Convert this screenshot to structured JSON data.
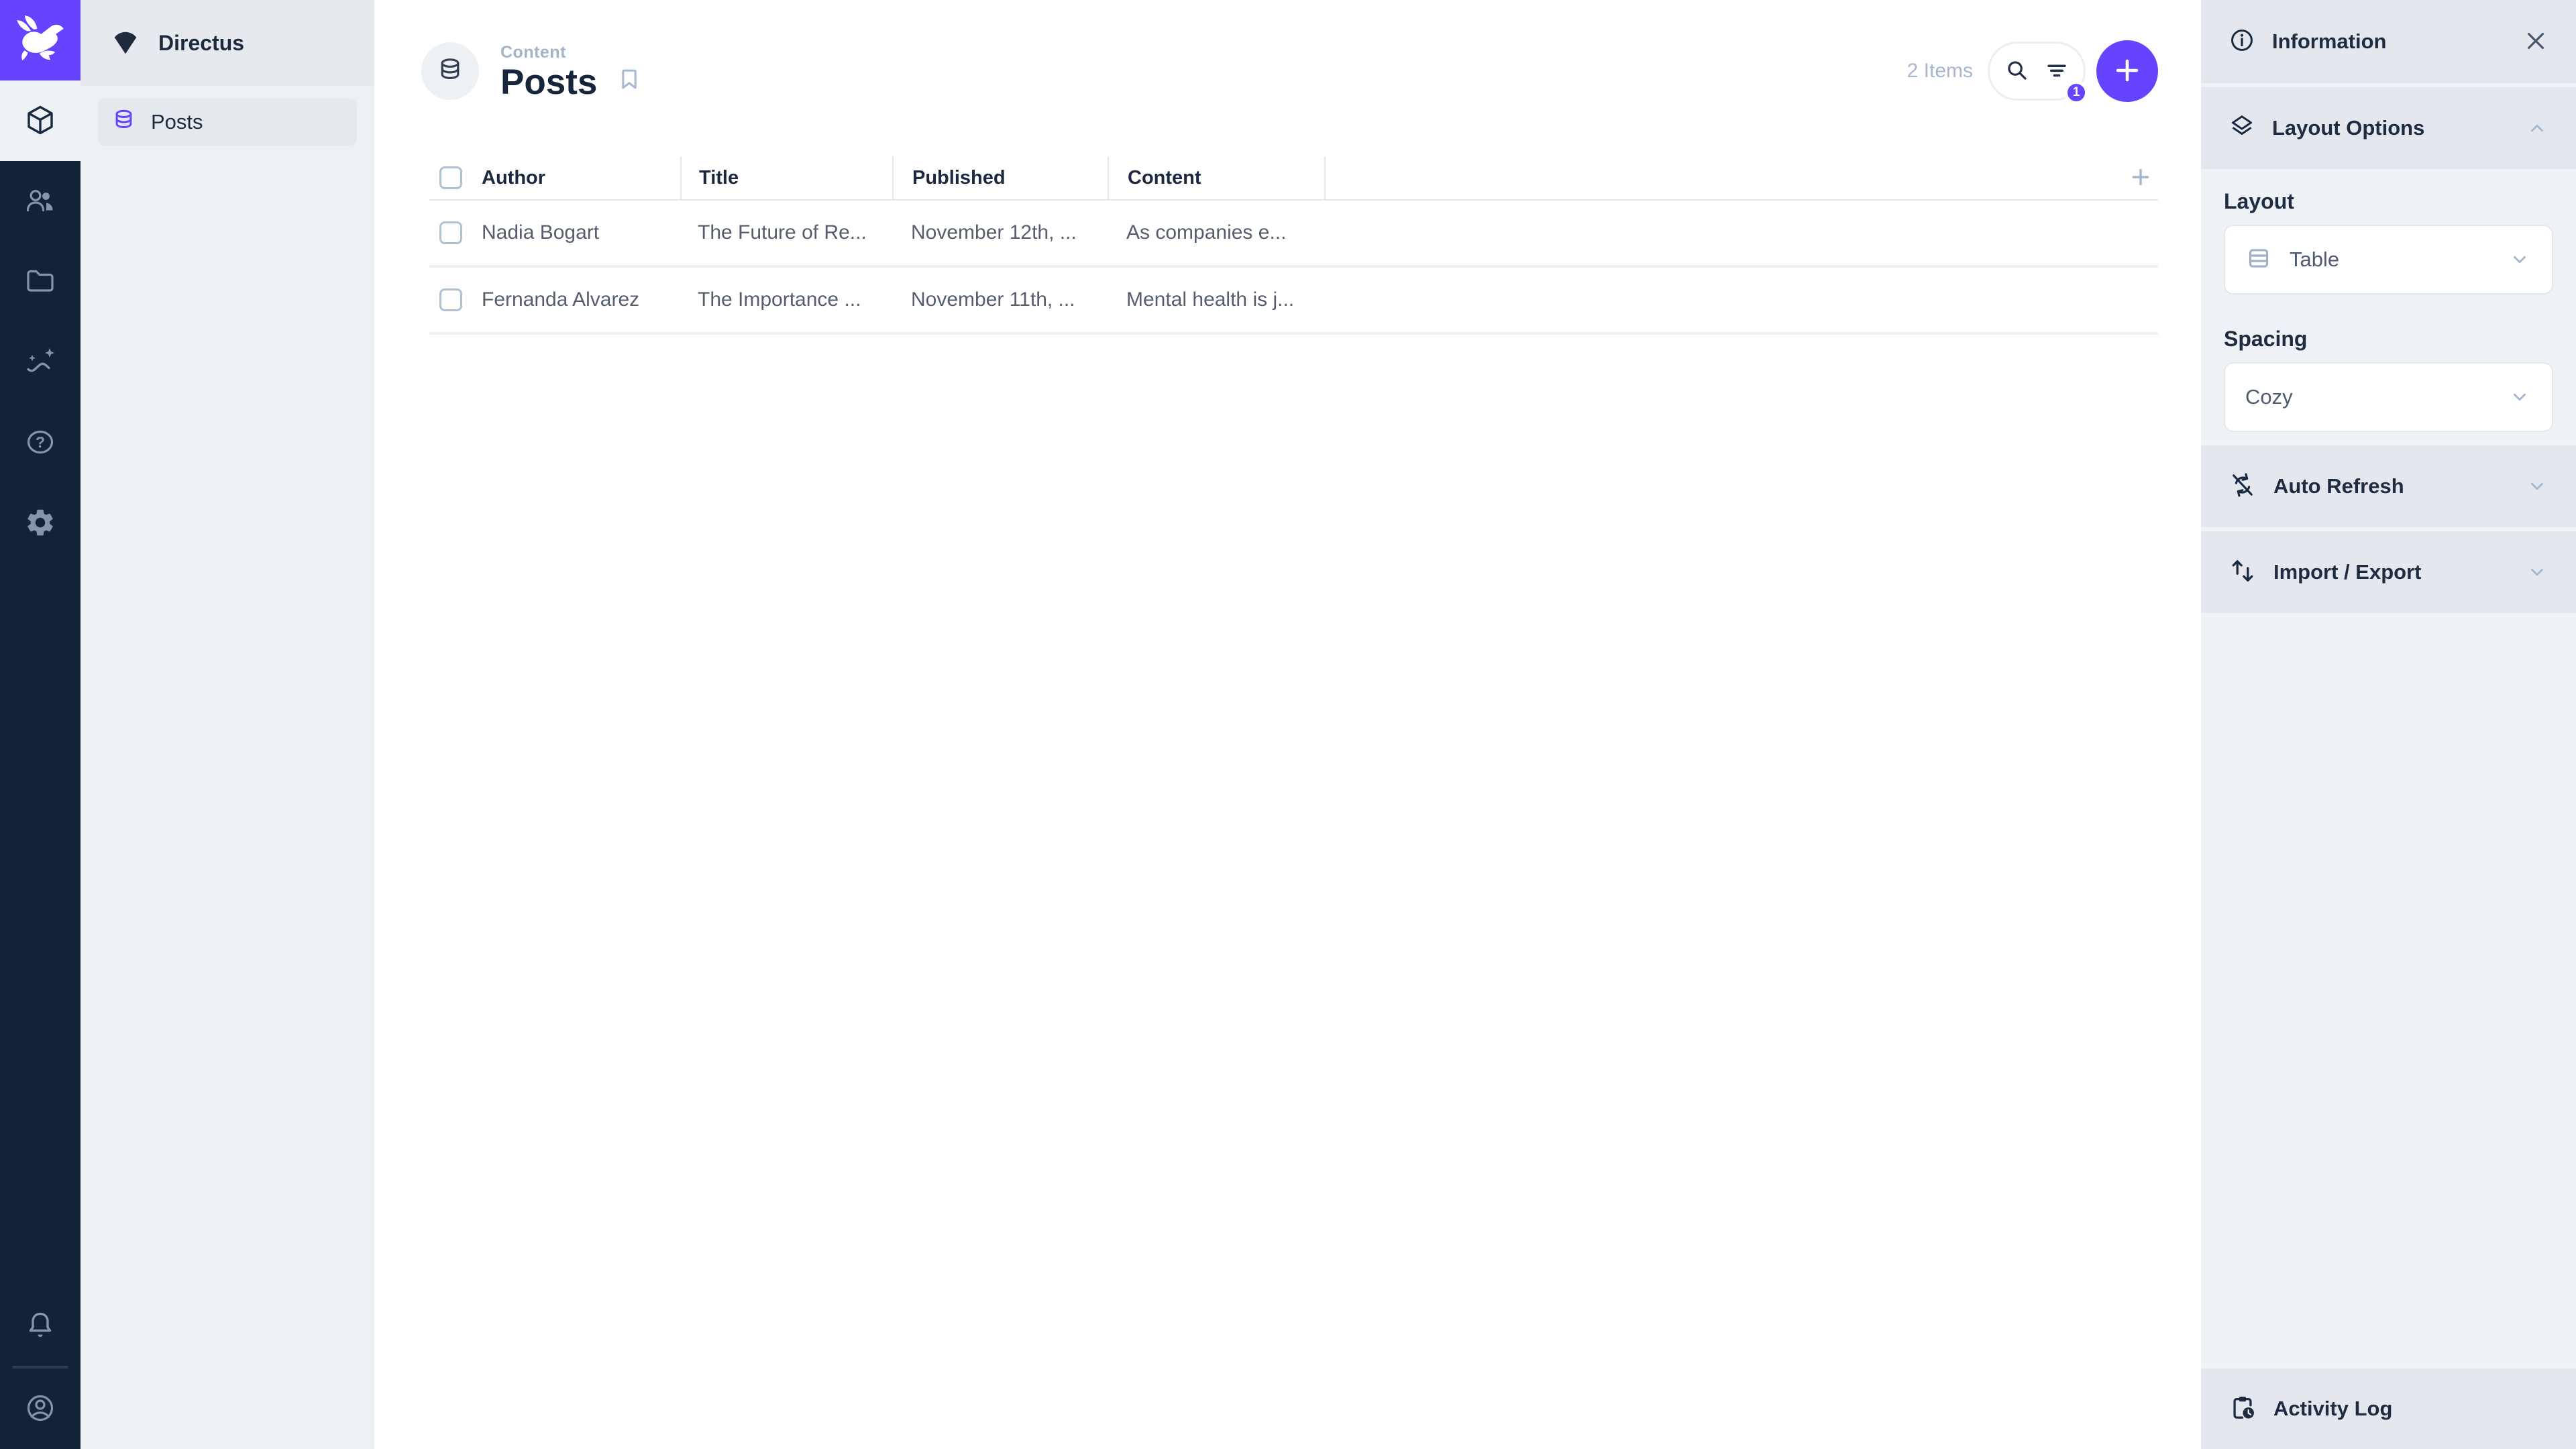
{
  "colors": {
    "accent": "#6644ff",
    "module_bar_bg": "#132337",
    "dark_text": "#16253c",
    "muted_text": "#a6b8cf",
    "row_text": "#555e6e"
  },
  "module_bar": {
    "modules": [
      {
        "name": "content",
        "icon": "box-icon",
        "active": true
      },
      {
        "name": "user-directory",
        "icon": "users-icon",
        "active": false
      },
      {
        "name": "file-library",
        "icon": "folder-icon",
        "active": false
      },
      {
        "name": "insights",
        "icon": "insights-icon",
        "active": false
      },
      {
        "name": "help",
        "icon": "help-icon",
        "active": false
      },
      {
        "name": "settings",
        "icon": "gear-icon",
        "active": false
      }
    ],
    "bottom": [
      {
        "name": "notifications",
        "icon": "bell-icon"
      },
      {
        "name": "account",
        "icon": "account-circle-icon"
      }
    ]
  },
  "nav": {
    "project_name": "Directus",
    "project_icon": "fan-icon",
    "items": [
      {
        "label": "Posts",
        "icon": "database-icon",
        "active": true
      }
    ]
  },
  "page": {
    "breadcrumb": "Content",
    "title": "Posts",
    "title_icon": "database-icon",
    "items_count": "2 Items",
    "filter_badge": "1"
  },
  "table": {
    "columns": [
      "Author",
      "Title",
      "Published",
      "Content"
    ],
    "rows": [
      {
        "author": "Nadia Bogart",
        "title": "The Future of Re...",
        "published": "November 12th, ...",
        "content": "As companies e..."
      },
      {
        "author": "Fernanda Alvarez",
        "title": "The Importance ...",
        "published": "November 11th, ...",
        "content": "Mental health is j..."
      }
    ]
  },
  "sidebar": {
    "title": "Information",
    "title_icon": "info-icon",
    "close_icon": "close-icon",
    "layout_options": {
      "label": "Layout Options",
      "icon": "layers-icon",
      "layout_label": "Layout",
      "layout_value": "Table",
      "layout_value_icon": "table-layout-icon",
      "spacing_label": "Spacing",
      "spacing_value": "Cozy"
    },
    "auto_refresh_label": "Auto Refresh",
    "auto_refresh_icon": "sync-disabled-icon",
    "import_export_label": "Import / Export",
    "import_export_icon": "swap-vertical-icon",
    "activity_log_label": "Activity Log",
    "activity_log_icon": "clipboard-clock-icon"
  }
}
